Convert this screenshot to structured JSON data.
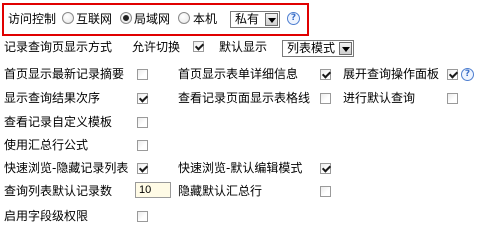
{
  "access": {
    "label": "访问控制",
    "options": [
      {
        "label": "互联网",
        "selected": false
      },
      {
        "label": "局域网",
        "selected": true
      },
      {
        "label": "本机",
        "selected": false
      }
    ],
    "select_value": "私有",
    "help_glyph": "?",
    "highlight_color": "#e00000"
  },
  "display_mode": {
    "label": "记录查询页显示方式",
    "toggle_label": "允许切换",
    "toggle_checked": true,
    "default_label": "默认显示",
    "default_value": "列表模式"
  },
  "settings": {
    "first_page_latest": {
      "label": "首页显示最新记录摘要",
      "checked": false
    },
    "first_page_detail": {
      "label": "首页显示表单详细信息",
      "checked": true
    },
    "expand_panel": {
      "label": "展开查询操作面板",
      "checked": true
    },
    "result_order": {
      "label": "显示查询结果次序",
      "checked": true
    },
    "show_grid": {
      "label": "查看记录页面显示表格线",
      "checked": false
    },
    "default_query": {
      "label": "进行默认查询",
      "checked": false
    },
    "custom_template": {
      "label": "查看记录自定义模板",
      "checked": false
    },
    "summary_formula": {
      "label": "使用汇总行公式",
      "checked": false
    },
    "quick_hide_list": {
      "label": "快速浏览-隐藏记录列表",
      "checked": true
    },
    "quick_default_edit": {
      "label": "快速浏览-默认编辑模式",
      "checked": true
    },
    "default_count": {
      "label": "查询列表默认记录数",
      "value": "10"
    },
    "hide_summary": {
      "label": "隐藏默认汇总行",
      "checked": false
    },
    "field_permission": {
      "label": "启用字段级权限",
      "checked": false
    }
  }
}
